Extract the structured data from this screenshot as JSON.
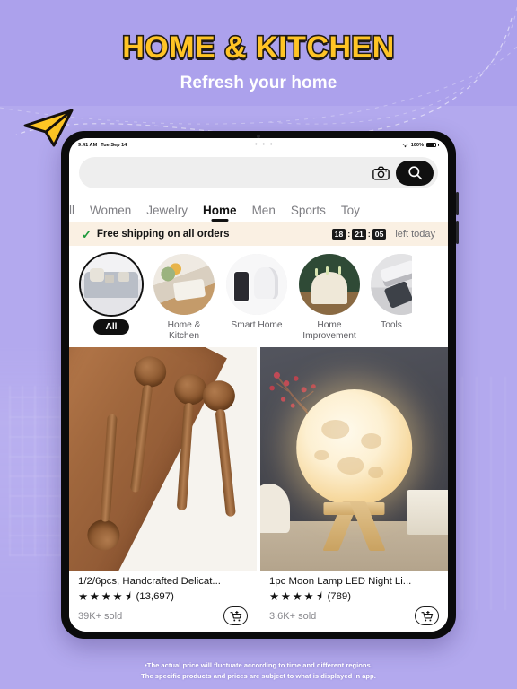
{
  "theme": {
    "background": "#aca1ec",
    "headline_fill": "#ffc425",
    "headline_stroke": "#1f1a16",
    "banner_bg": "#faf0e3",
    "accent_dark": "#101010"
  },
  "header": {
    "title": "HOME & KITCHEN",
    "subtitle": "Refresh your home",
    "plane_icon": "paper-plane-icon"
  },
  "device": {
    "status_bar": {
      "time": "9:41 AM",
      "date": "Tue Sep 14",
      "center": "• • •",
      "battery_pct": "100%",
      "wifi_icon": "wifi-icon",
      "battery_icon": "battery-icon"
    }
  },
  "search": {
    "placeholder": "",
    "value": "",
    "camera_icon": "camera-icon",
    "search_icon": "search-icon"
  },
  "tabs": [
    {
      "label": "ll",
      "active": false,
      "clipped": true
    },
    {
      "label": "Women",
      "active": false
    },
    {
      "label": "Jewelry",
      "active": false
    },
    {
      "label": "Home",
      "active": true
    },
    {
      "label": "Men",
      "active": false
    },
    {
      "label": "Sports",
      "active": false
    },
    {
      "label": "Toy",
      "active": false
    }
  ],
  "shipping_banner": {
    "check_icon": "check-icon",
    "text": "Free shipping on all orders",
    "hours": "18",
    "minutes": "21",
    "seconds": "05",
    "separator": ":",
    "suffix": "left today"
  },
  "categories": [
    {
      "label": "All",
      "selected": true,
      "style": "pill",
      "thumb": "sofa-thumb"
    },
    {
      "label": "Home &\nKitchen",
      "selected": false,
      "style": "text",
      "thumb": "table-setting-thumb"
    },
    {
      "label": "Smart Home",
      "selected": false,
      "style": "text",
      "thumb": "security-camera-thumb"
    },
    {
      "label": "Home\nImprovement",
      "selected": false,
      "style": "text",
      "thumb": "tablecloth-thumb"
    },
    {
      "label": "Tools",
      "selected": false,
      "style": "text",
      "thumb": "power-tool-thumb"
    }
  ],
  "products": [
    {
      "title": "1/2/6pcs, Handcrafted Delicat...",
      "stars": "★★★★",
      "half_star": "⯨",
      "rating_count": "(13,697)",
      "sold": "39K+ sold",
      "cart_icon": "cart-plus-icon",
      "image": "wooden-spoons-image"
    },
    {
      "title": "1pc Moon Lamp LED Night Li...",
      "stars": "★★★★",
      "half_star": "⯨",
      "rating_count": "(789)",
      "sold": "3.6K+ sold",
      "cart_icon": "cart-plus-icon",
      "image": "moon-lamp-image"
    }
  ],
  "footer": {
    "line1": "•The actual price will fluctuate according to time and different regions.",
    "line2": "The specific products and prices are subject to what is displayed in app."
  }
}
